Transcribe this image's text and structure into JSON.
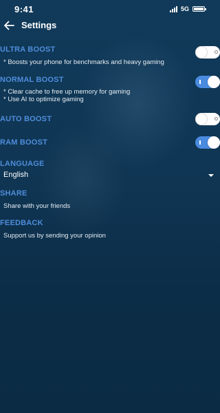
{
  "status_bar": {
    "time": "9:41",
    "network": "5G"
  },
  "header": {
    "title": "Settings",
    "back_icon": "arrow-left-icon"
  },
  "settings": {
    "ultra_boost": {
      "title": "ULTRA BOOST",
      "description": "* Boosts your phone for benchmarks and heavy gaming",
      "enabled": false
    },
    "normal_boost": {
      "title": "NORMAL BOOST",
      "description_lines": [
        "* Clear cache to free up memory for gaming",
        "* Use AI to optimize gaming"
      ],
      "enabled": true
    },
    "auto_boost": {
      "title": "AUTO BOOST",
      "enabled": false
    },
    "ram_boost": {
      "title": "RAM BOOST",
      "enabled": true
    },
    "language": {
      "title": "LANGUAGE",
      "selected": "English"
    },
    "share": {
      "title": "SHARE",
      "description": "Share with your friends"
    },
    "feedback": {
      "title": "FEEDBACK",
      "description": "Support us by sending your opinion"
    }
  },
  "colors": {
    "accent": "#4e8ddb",
    "toggle_on": "#4a8be0",
    "background": "#0c2d47"
  }
}
